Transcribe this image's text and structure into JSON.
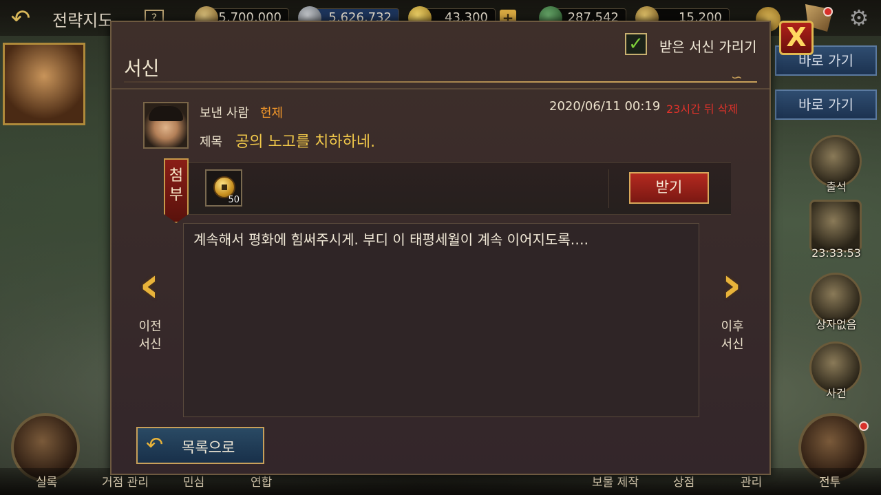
{
  "topbar": {
    "title": "전략지도",
    "help_badge": "?",
    "resources": [
      "5,700,000",
      "5,626,732",
      "43,300",
      "287,542",
      "15,200"
    ],
    "plus": "+"
  },
  "side": {
    "goto_1": "바로 가기",
    "goto_2": "바로 가기",
    "attendance": "출석",
    "timer": "23:33:53",
    "no_box": "상자없음",
    "event": "사건",
    "battle": "전투"
  },
  "bottom_nav": [
    "실록",
    "거점 관리",
    "민심",
    "연합",
    "보물 제작",
    "상점",
    "관리"
  ],
  "modal": {
    "title": "서신",
    "hide_checkbox": {
      "label": "받은 서신 가리기",
      "checked": true
    },
    "close_label": "X",
    "sender_label": "보낸 사람",
    "sender_name": "헌제",
    "subject_label": "제목",
    "subject": "공의 노고를 치하하네.",
    "date": "2020/06/11 00:19",
    "expire": "23시간 뒤 삭제",
    "attachment": {
      "ribbon": "첨부",
      "item_icon": "coin-icon",
      "quantity": "50",
      "receive_button": "받기"
    },
    "body": "계속해서 평화에 힘써주시게. 부디 이 태평세월이 계속 이어지도록….",
    "prev_label": "이전 서신",
    "next_label": "이후 서신",
    "back_to_list": "목록으로"
  },
  "colors": {
    "modal_bg": "#3a2c2a",
    "accent_gold": "#e8b33a",
    "sender_orange": "#f0962a",
    "subject_yellow": "#f2c94a",
    "expire_red": "#e0322a",
    "receive_red": "#b42a20"
  }
}
